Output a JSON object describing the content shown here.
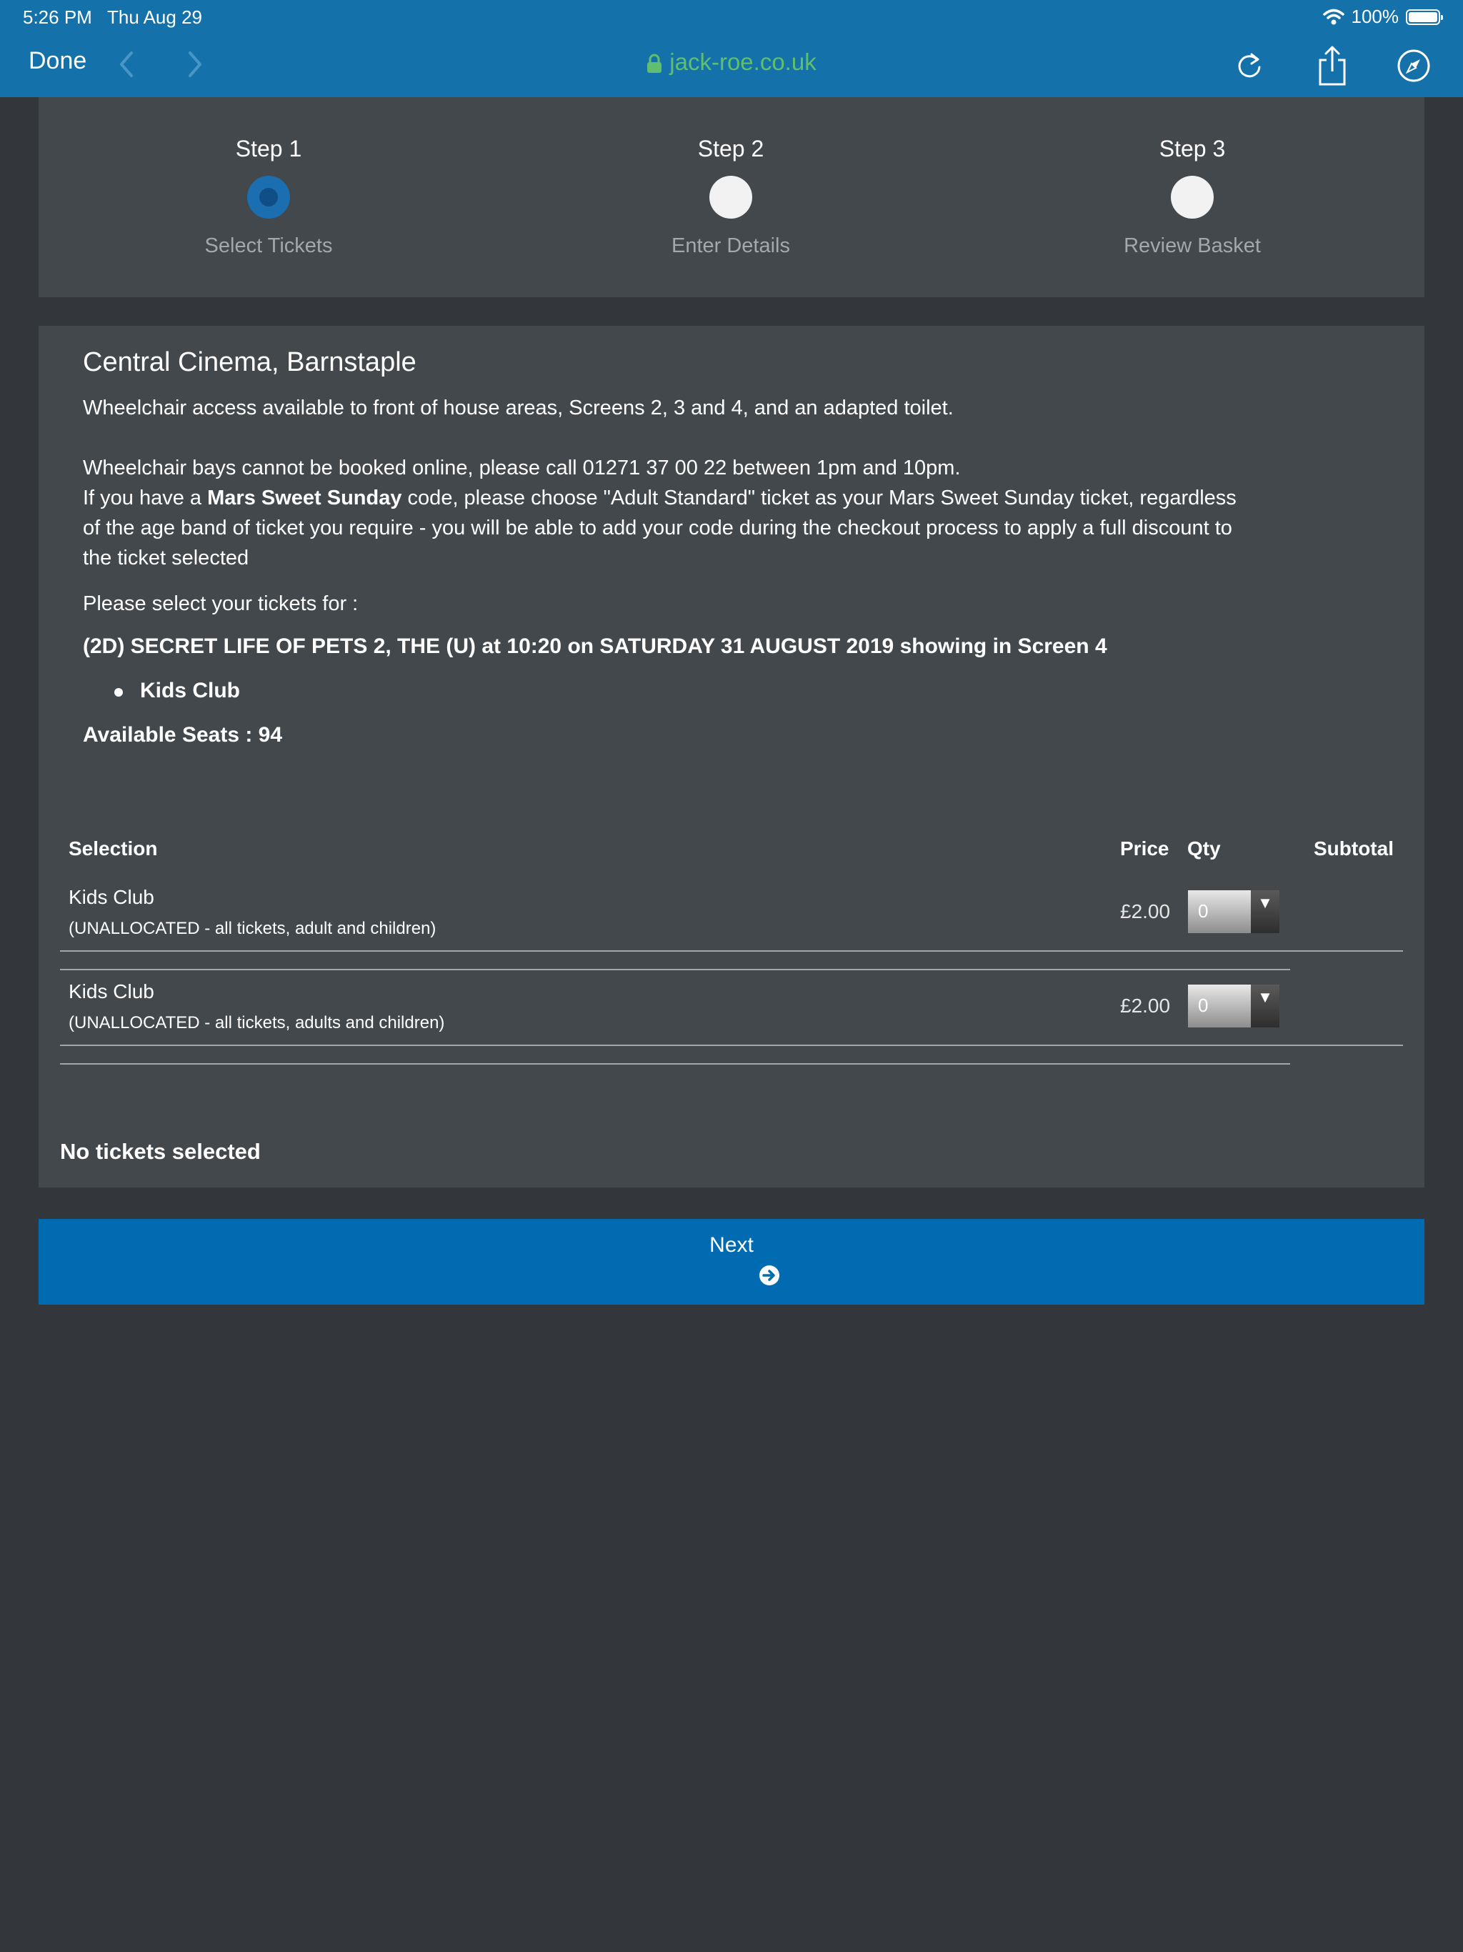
{
  "status_bar": {
    "time": "5:26 PM",
    "date": "Thu Aug 29",
    "battery": "100%"
  },
  "browser": {
    "done_label": "Done",
    "url": "jack-roe.co.uk"
  },
  "steps": [
    {
      "title": "Step 1",
      "label": "Select Tickets",
      "active": true
    },
    {
      "title": "Step 2",
      "label": "Enter Details",
      "active": false
    },
    {
      "title": "Step 3",
      "label": "Review Basket",
      "active": false
    }
  ],
  "cinema": {
    "name": "Central Cinema, Barnstaple",
    "access_note": "Wheelchair access available to front of house areas, Screens 2, 3 and 4, and an adapted toilet.",
    "bays_note": "Wheelchair bays cannot be booked online, please call 01271 37 00 22 between 1pm and 10pm.",
    "promo_prefix": "If you have a ",
    "promo_bold": "Mars Sweet Sunday",
    "promo_line1_rest": " code, please choose \"Adult Standard\" ticket as your Mars Sweet Sunday ticket, regardless",
    "promo_line2": "of the age band of ticket you require - you will be able to add your code during the checkout process to apply a full discount to",
    "promo_line3": "the ticket selected",
    "select_prompt": "Please select your tickets for :",
    "film": "(2D) SECRET LIFE OF PETS 2, THE (U) at 10:20 on SATURDAY 31 AUGUST 2019 showing in Screen 4",
    "attribute": "Kids Club",
    "available_seats": "Available Seats : 94"
  },
  "table": {
    "headers": {
      "selection": "Selection",
      "price": "Price",
      "qty": "Qty",
      "subtotal": "Subtotal"
    },
    "rows": [
      {
        "name": "Kids Club",
        "note": "(UNALLOCATED - all tickets, adult and children)",
        "price": "£2.00",
        "qty": "0"
      },
      {
        "name": "Kids Club",
        "note": "(UNALLOCATED - all tickets, adults and children)",
        "price": "£2.00",
        "qty": "0"
      }
    ]
  },
  "summary": "No tickets selected",
  "next_label": "Next",
  "colors": {
    "chrome": "#1471aa",
    "panel": "#43484c",
    "background": "#33363b",
    "primary_button": "#006bb0",
    "url_green": "#5fbf6f"
  }
}
